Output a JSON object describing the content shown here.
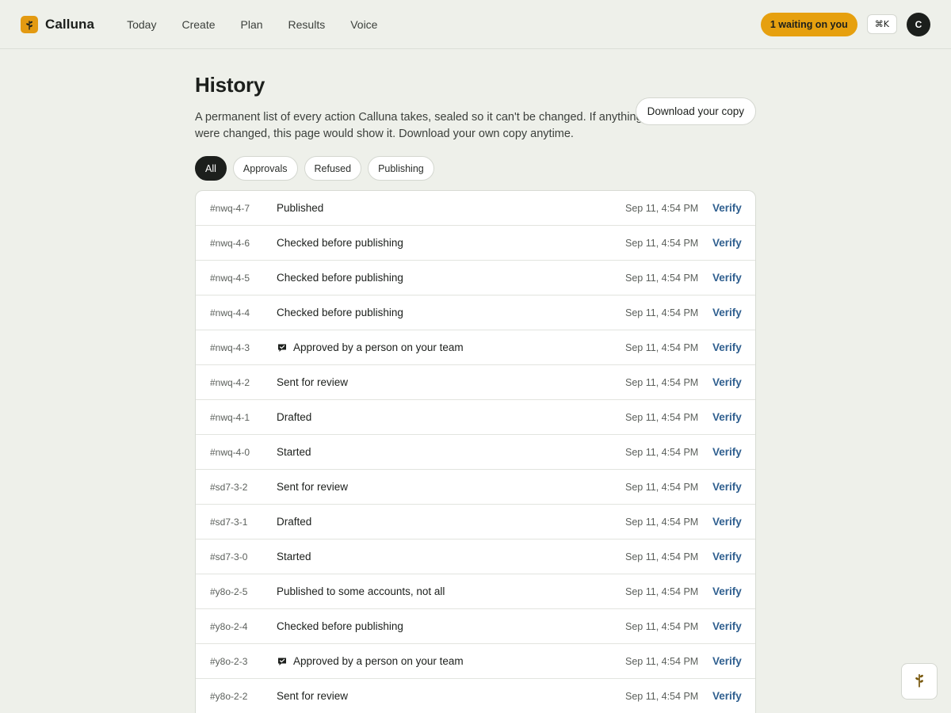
{
  "brand": {
    "name": "Calluna",
    "accent": "#e39a12"
  },
  "nav": [
    "Today",
    "Create",
    "Plan",
    "Results",
    "Voice"
  ],
  "header": {
    "waiting": "1 waiting on you",
    "shortcut": "⌘K",
    "avatar": "C"
  },
  "page": {
    "title": "History",
    "download": "Download your copy",
    "subtitle": "A permanent list of every action Calluna takes, sealed so it can't be changed. If anything were changed, this page would show it. Download your own copy anytime."
  },
  "filters": [
    {
      "label": "All",
      "active": true
    },
    {
      "label": "Approvals",
      "active": false
    },
    {
      "label": "Refused",
      "active": false
    },
    {
      "label": "Publishing",
      "active": false
    }
  ],
  "verify_label": "Verify",
  "rows": [
    {
      "id": "#nwq-4-7",
      "action": "Published",
      "time": "Sep 11, 4:54 PM",
      "icon": ""
    },
    {
      "id": "#nwq-4-6",
      "action": "Checked before publishing",
      "time": "Sep 11, 4:54 PM",
      "icon": ""
    },
    {
      "id": "#nwq-4-5",
      "action": "Checked before publishing",
      "time": "Sep 11, 4:54 PM",
      "icon": ""
    },
    {
      "id": "#nwq-4-4",
      "action": "Checked before publishing",
      "time": "Sep 11, 4:54 PM",
      "icon": ""
    },
    {
      "id": "#nwq-4-3",
      "action": "Approved by a person on your team",
      "time": "Sep 11, 4:54 PM",
      "icon": "approval-chat-icon"
    },
    {
      "id": "#nwq-4-2",
      "action": "Sent for review",
      "time": "Sep 11, 4:54 PM",
      "icon": ""
    },
    {
      "id": "#nwq-4-1",
      "action": "Drafted",
      "time": "Sep 11, 4:54 PM",
      "icon": ""
    },
    {
      "id": "#nwq-4-0",
      "action": "Started",
      "time": "Sep 11, 4:54 PM",
      "icon": ""
    },
    {
      "id": "#sd7-3-2",
      "action": "Sent for review",
      "time": "Sep 11, 4:54 PM",
      "icon": ""
    },
    {
      "id": "#sd7-3-1",
      "action": "Drafted",
      "time": "Sep 11, 4:54 PM",
      "icon": ""
    },
    {
      "id": "#sd7-3-0",
      "action": "Started",
      "time": "Sep 11, 4:54 PM",
      "icon": ""
    },
    {
      "id": "#y8o-2-5",
      "action": "Published to some accounts, not all",
      "time": "Sep 11, 4:54 PM",
      "icon": ""
    },
    {
      "id": "#y8o-2-4",
      "action": "Checked before publishing",
      "time": "Sep 11, 4:54 PM",
      "icon": ""
    },
    {
      "id": "#y8o-2-3",
      "action": "Approved by a person on your team",
      "time": "Sep 11, 4:54 PM",
      "icon": "approval-chat-icon"
    },
    {
      "id": "#y8o-2-2",
      "action": "Sent for review",
      "time": "Sep 11, 4:54 PM",
      "icon": ""
    }
  ]
}
